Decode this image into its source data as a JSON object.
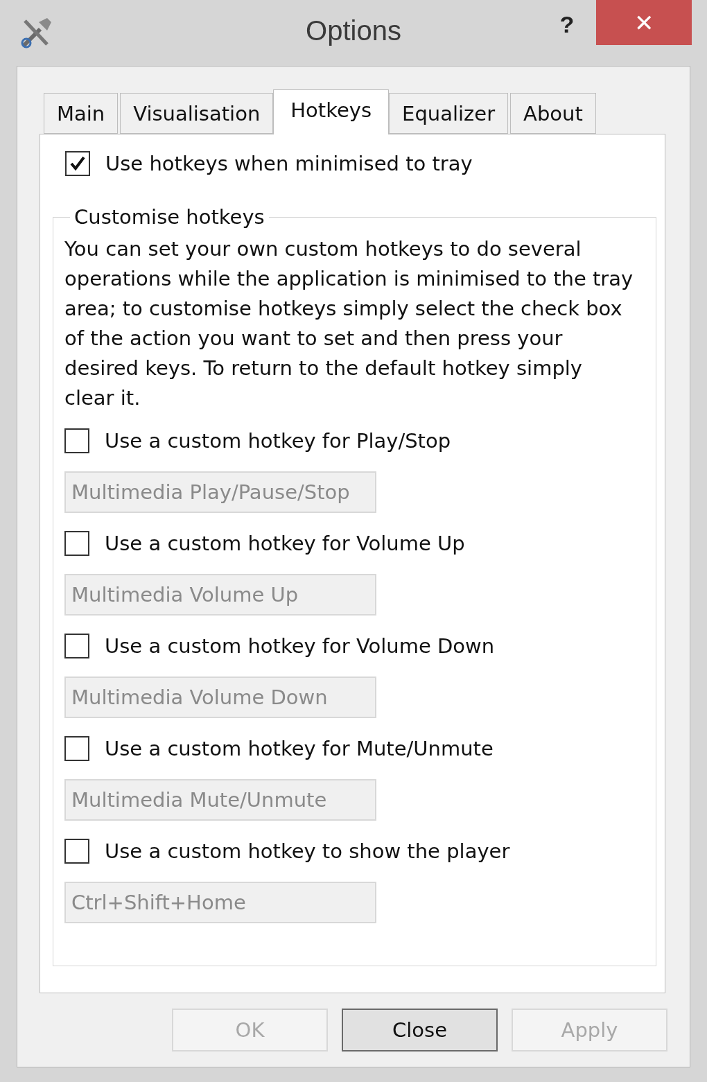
{
  "window": {
    "title": "Options",
    "help": "?",
    "close": "✕"
  },
  "tabs": [
    {
      "label": "Main",
      "selected": false
    },
    {
      "label": "Visualisation",
      "selected": false
    },
    {
      "label": "Hotkeys",
      "selected": true
    },
    {
      "label": "Equalizer",
      "selected": false
    },
    {
      "label": "About",
      "selected": false
    }
  ],
  "tray_option": {
    "label": "Use hotkeys when minimised to tray",
    "checked": true
  },
  "group": {
    "title": "Customise hotkeys",
    "description": "You can set your own custom hotkeys to do several operations while the application is minimised to the tray area; to customise hotkeys simply select the check box of the action you want to set and then press your desired keys. To return to the default hotkey simply clear it.",
    "hotkeys": [
      {
        "label": "Use a custom hotkey for Play/Stop",
        "checked": false,
        "value": "Multimedia Play/Pause/Stop",
        "disabled": true
      },
      {
        "label": "Use a custom hotkey for Volume Up",
        "checked": false,
        "value": "Multimedia Volume Up",
        "disabled": true
      },
      {
        "label": "Use a custom hotkey for Volume Down",
        "checked": false,
        "value": "Multimedia Volume Down",
        "disabled": true
      },
      {
        "label": "Use a custom hotkey for Mute/Unmute",
        "checked": false,
        "value": "Multimedia Mute/Unmute",
        "disabled": true
      },
      {
        "label": "Use a custom hotkey to show the player",
        "checked": false,
        "value": "Ctrl+Shift+Home",
        "disabled": true
      }
    ]
  },
  "buttons": [
    {
      "label": "OK",
      "disabled": true,
      "default": false
    },
    {
      "label": "Close",
      "disabled": false,
      "default": true
    },
    {
      "label": "Apply",
      "disabled": true,
      "default": false
    }
  ]
}
